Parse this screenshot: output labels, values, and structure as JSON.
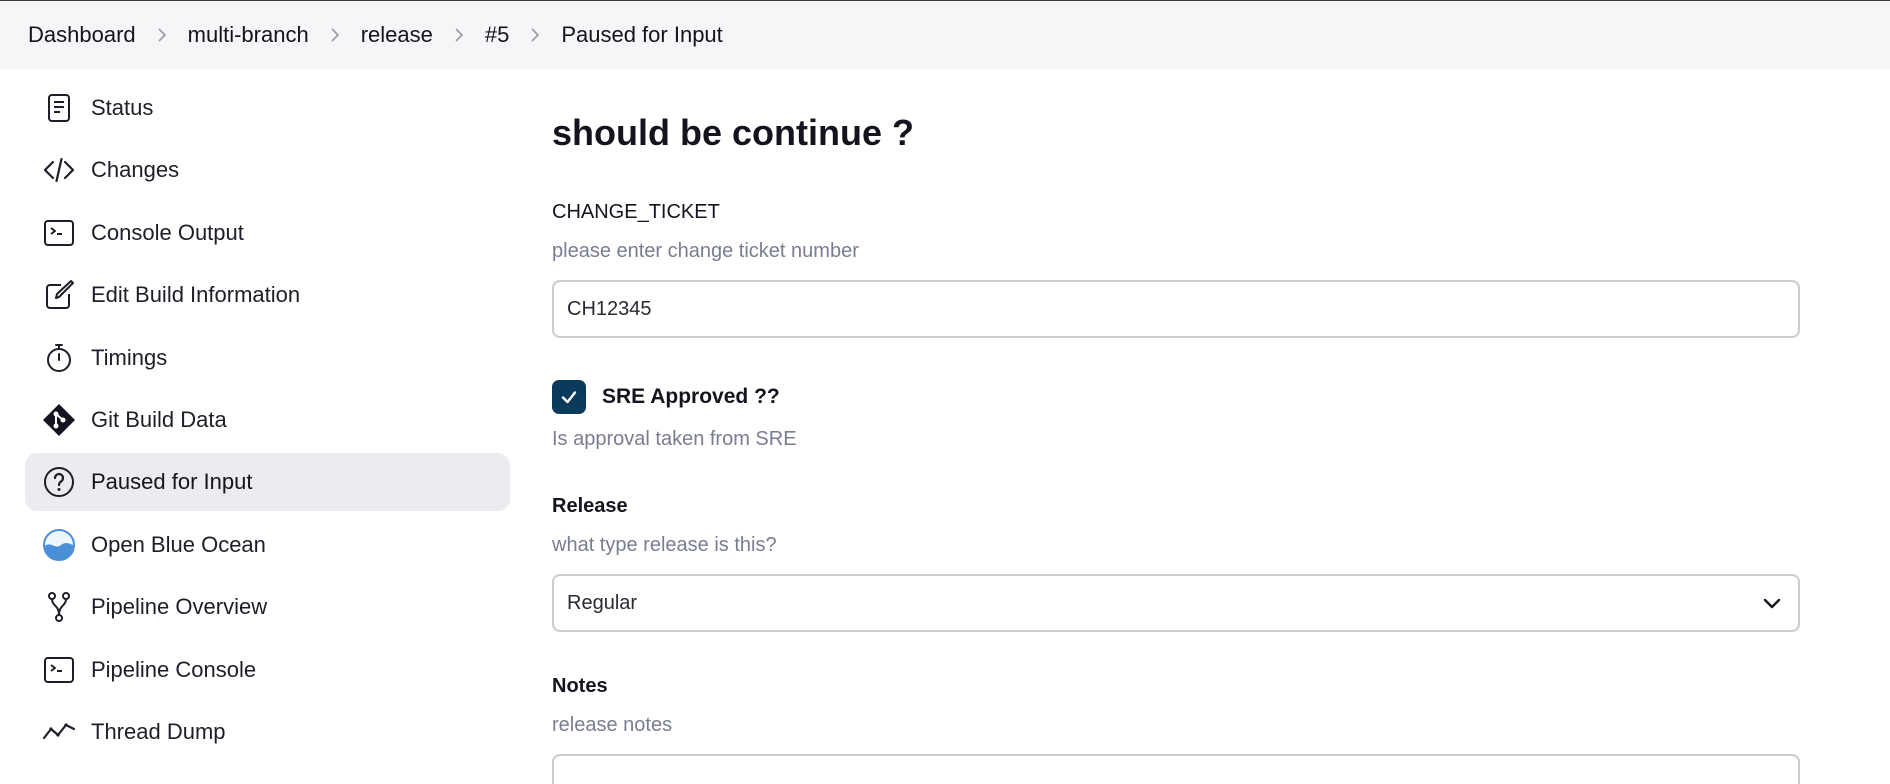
{
  "breadcrumb": {
    "items": [
      {
        "label": "Dashboard"
      },
      {
        "label": "multi-branch"
      },
      {
        "label": "release"
      },
      {
        "label": "#5"
      },
      {
        "label": "Paused for Input"
      }
    ]
  },
  "sidebar": {
    "items": [
      {
        "label": "Status",
        "icon": "status-icon"
      },
      {
        "label": "Changes",
        "icon": "code-icon"
      },
      {
        "label": "Console Output",
        "icon": "terminal-icon"
      },
      {
        "label": "Edit Build Information",
        "icon": "edit-icon"
      },
      {
        "label": "Timings",
        "icon": "stopwatch-icon"
      },
      {
        "label": "Git Build Data",
        "icon": "git-icon"
      },
      {
        "label": "Paused for Input",
        "icon": "question-icon",
        "active": true
      },
      {
        "label": "Open Blue Ocean",
        "icon": "blue-ocean-icon"
      },
      {
        "label": "Pipeline Overview",
        "icon": "pipeline-icon"
      },
      {
        "label": "Pipeline Console",
        "icon": "terminal-icon"
      },
      {
        "label": "Thread Dump",
        "icon": "pulse-icon"
      }
    ]
  },
  "main": {
    "title": "should be continue ?",
    "change_ticket": {
      "name": "CHANGE_TICKET",
      "description": "please enter change ticket number",
      "value": "CH12345"
    },
    "sre_approved": {
      "label": "SRE Approved ??",
      "checked": true,
      "description": "Is approval taken from SRE"
    },
    "release": {
      "name": "Release",
      "description": "what type release is this?",
      "selected": "Regular"
    },
    "notes": {
      "name": "Notes",
      "description": "release notes"
    }
  },
  "colors": {
    "breadcrumb_bg": "#f6f6f8",
    "active_item_bg": "#ebecef",
    "checkbox_bg": "#0b3a5b",
    "description_text": "#7a7d92",
    "input_border": "#c7cccf",
    "blue_ocean": "#4a90d9"
  }
}
